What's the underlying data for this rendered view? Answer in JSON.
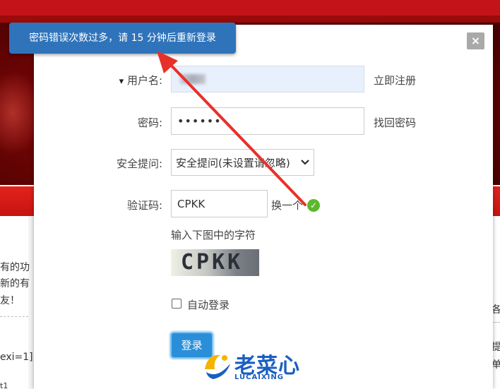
{
  "background": {
    "left_lines": [
      "有的功",
      "新的有",
      "友！",
      "exi=1]",
      "t1"
    ],
    "right_lines": [
      "各",
      "提",
      "单"
    ]
  },
  "tooltip": {
    "message": "密码错误次数过多，请 15 分钟后重新登录"
  },
  "dialog": {
    "close_label": "×",
    "username": {
      "label": "用户名:",
      "link": "立即注册"
    },
    "password": {
      "label": "密码:",
      "value": "••••••",
      "link": "找回密码"
    },
    "security": {
      "label": "安全提问:",
      "selected": "安全提问(未设置请忽略)"
    },
    "captcha": {
      "label": "验证码:",
      "value": "CPKK",
      "refresh": "换一个",
      "hint": "输入下图中的字符",
      "image_text": "CPKK"
    },
    "remember": {
      "label": "自动登录",
      "checked": false
    },
    "login_label": "登录"
  },
  "watermark": {
    "name": "老菜心",
    "sub": "LUCAIXING"
  },
  "colors": {
    "tooltip": "#2f74bb",
    "login_button": "#2a8fd8",
    "check": "#5cb82c",
    "arrow": "#e8302a"
  },
  "icons": {
    "close": "close-icon",
    "dropdown": "caret-down-icon",
    "check": "check-circle-icon",
    "select": "chevron-down-icon"
  }
}
